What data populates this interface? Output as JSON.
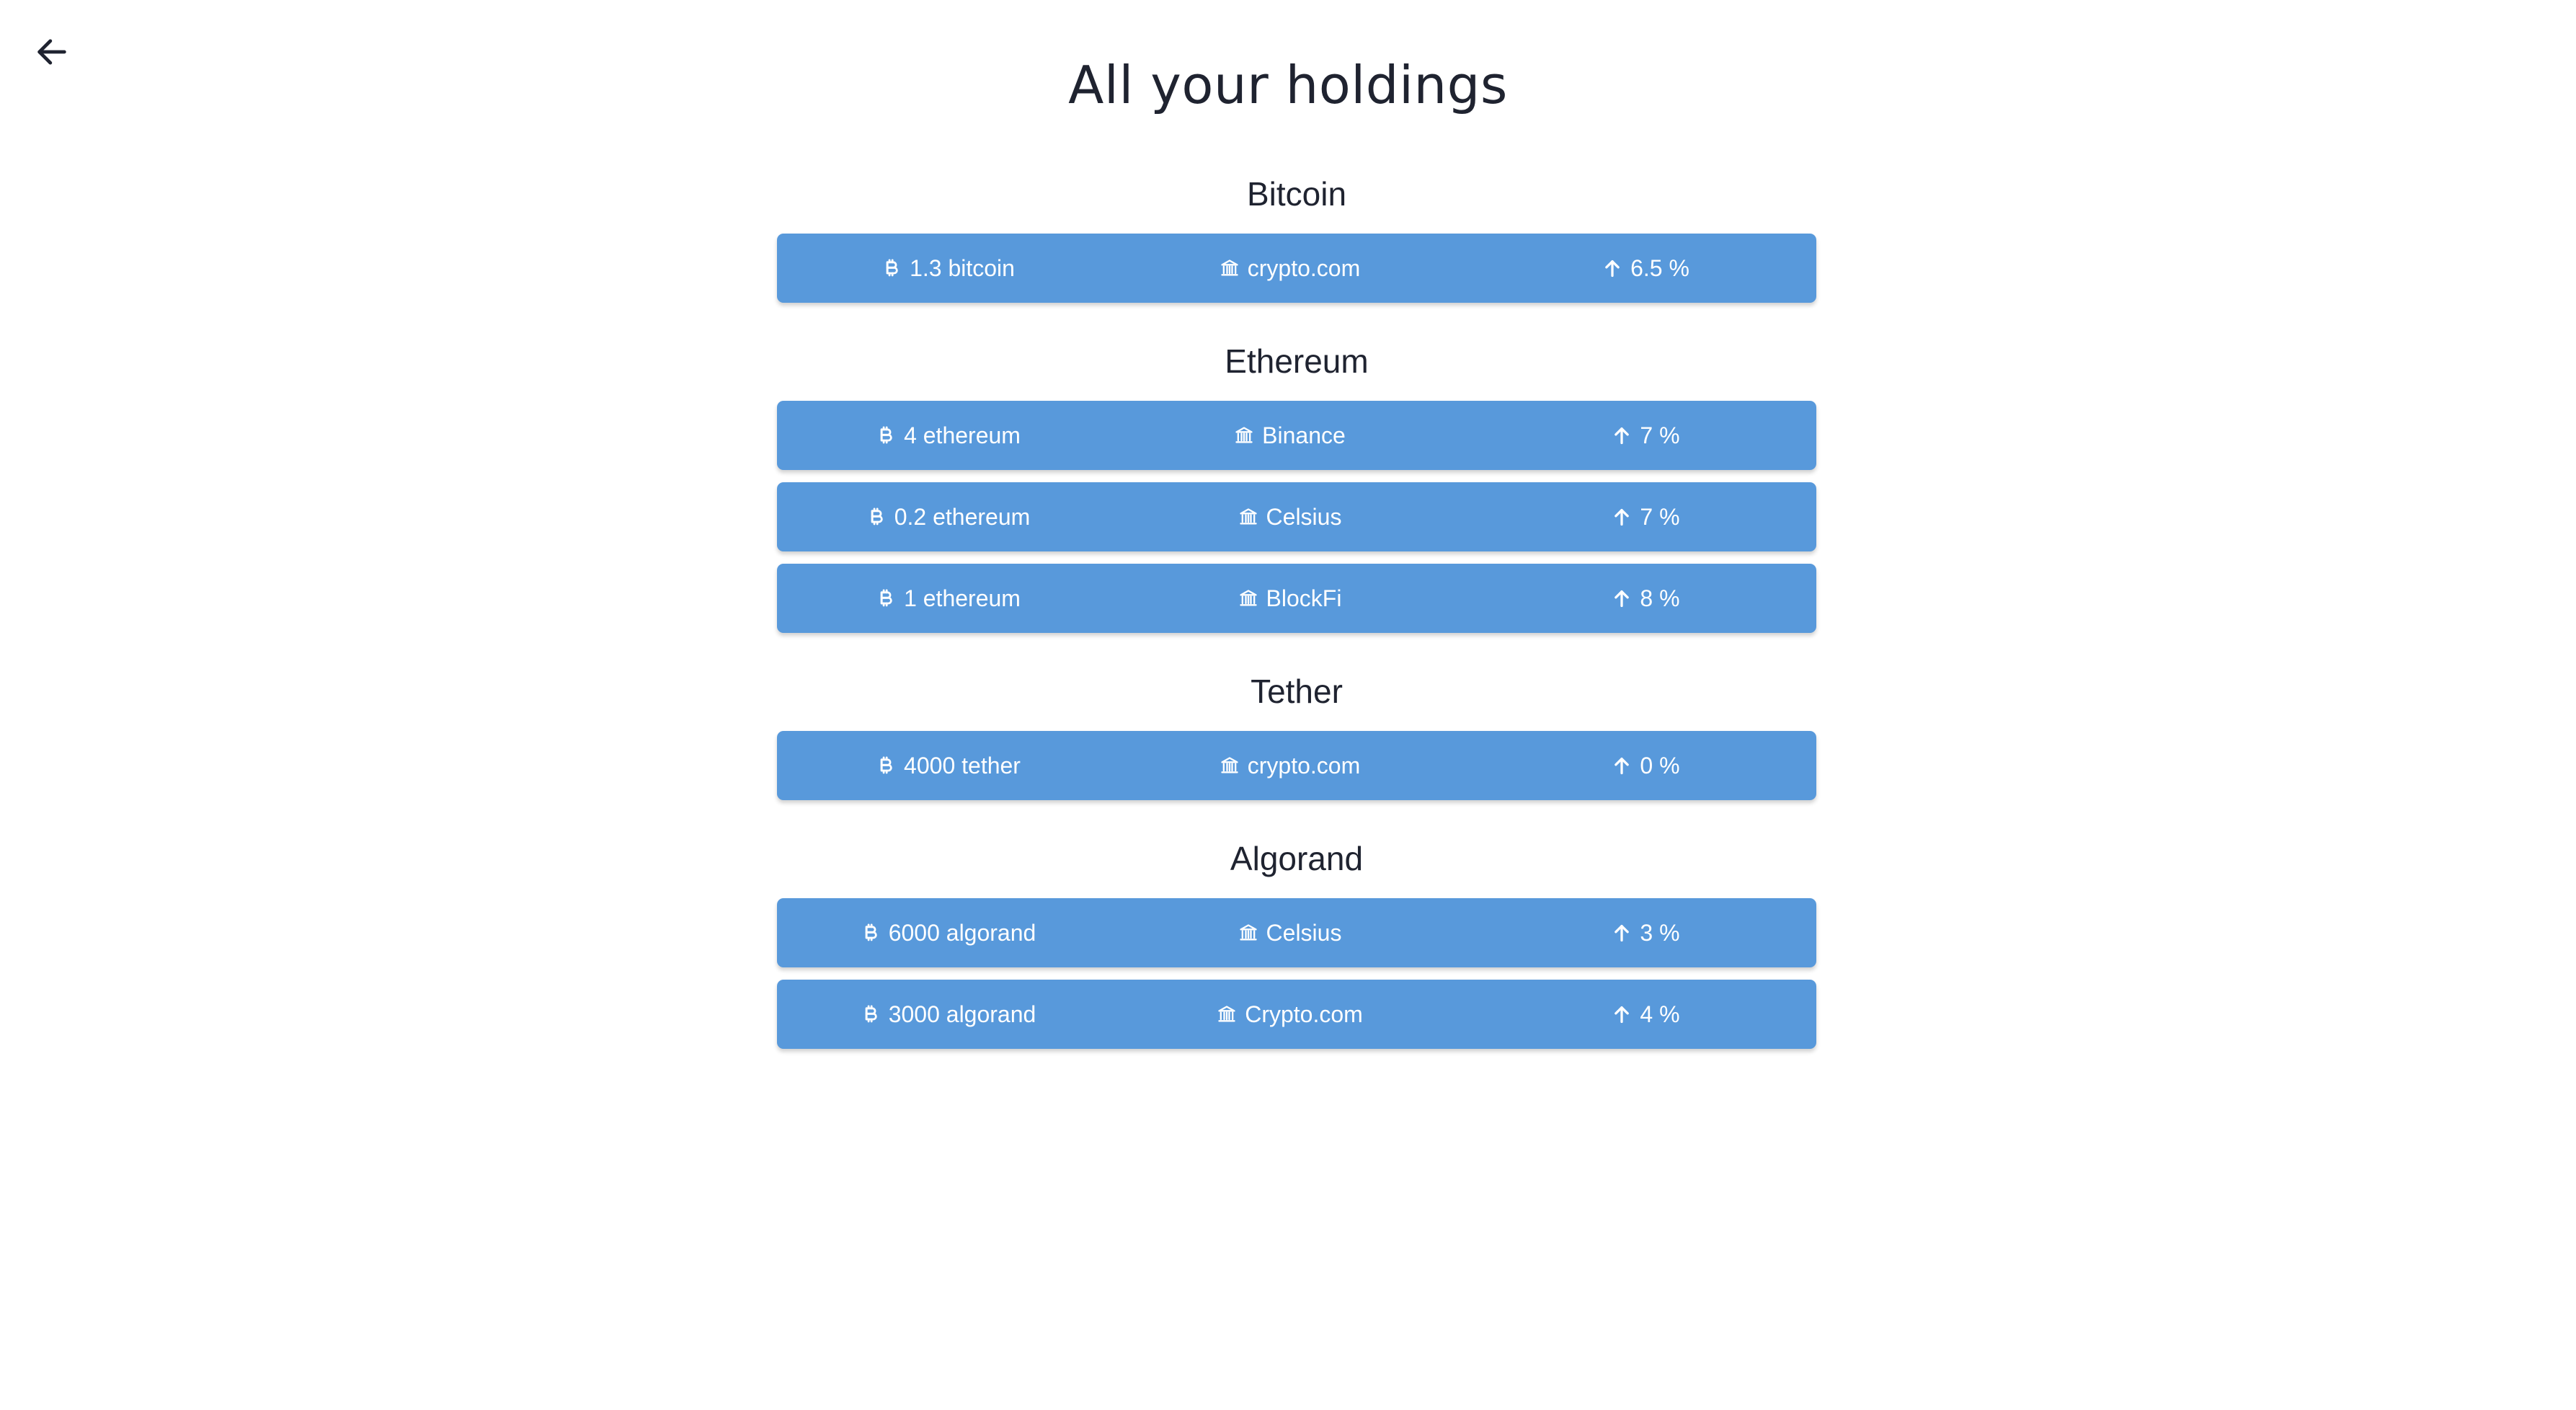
{
  "header": {
    "title": "All your holdings",
    "back_icon": "arrow-left-icon"
  },
  "icons": {
    "amount": "bitcoin-icon",
    "platform": "bank-icon",
    "rate": "arrow-up-icon"
  },
  "colors": {
    "row_background": "#5899db",
    "row_text": "#ffffff",
    "title_text": "#1f2330"
  },
  "groups": [
    {
      "name": "Bitcoin",
      "rows": [
        {
          "amount": "1.3 bitcoin",
          "platform": "crypto.com",
          "rate": "6.5 %"
        }
      ]
    },
    {
      "name": "Ethereum",
      "rows": [
        {
          "amount": "4 ethereum",
          "platform": "Binance",
          "rate": "7 %"
        },
        {
          "amount": "0.2 ethereum",
          "platform": "Celsius",
          "rate": "7 %"
        },
        {
          "amount": "1 ethereum",
          "platform": "BlockFi",
          "rate": "8 %"
        }
      ]
    },
    {
      "name": "Tether",
      "rows": [
        {
          "amount": "4000 tether",
          "platform": "crypto.com",
          "rate": "0 %"
        }
      ]
    },
    {
      "name": "Algorand",
      "rows": [
        {
          "amount": "6000 algorand",
          "platform": "Celsius",
          "rate": "3 %"
        },
        {
          "amount": "3000 algorand",
          "platform": "Crypto.com",
          "rate": "4 %"
        }
      ]
    }
  ]
}
